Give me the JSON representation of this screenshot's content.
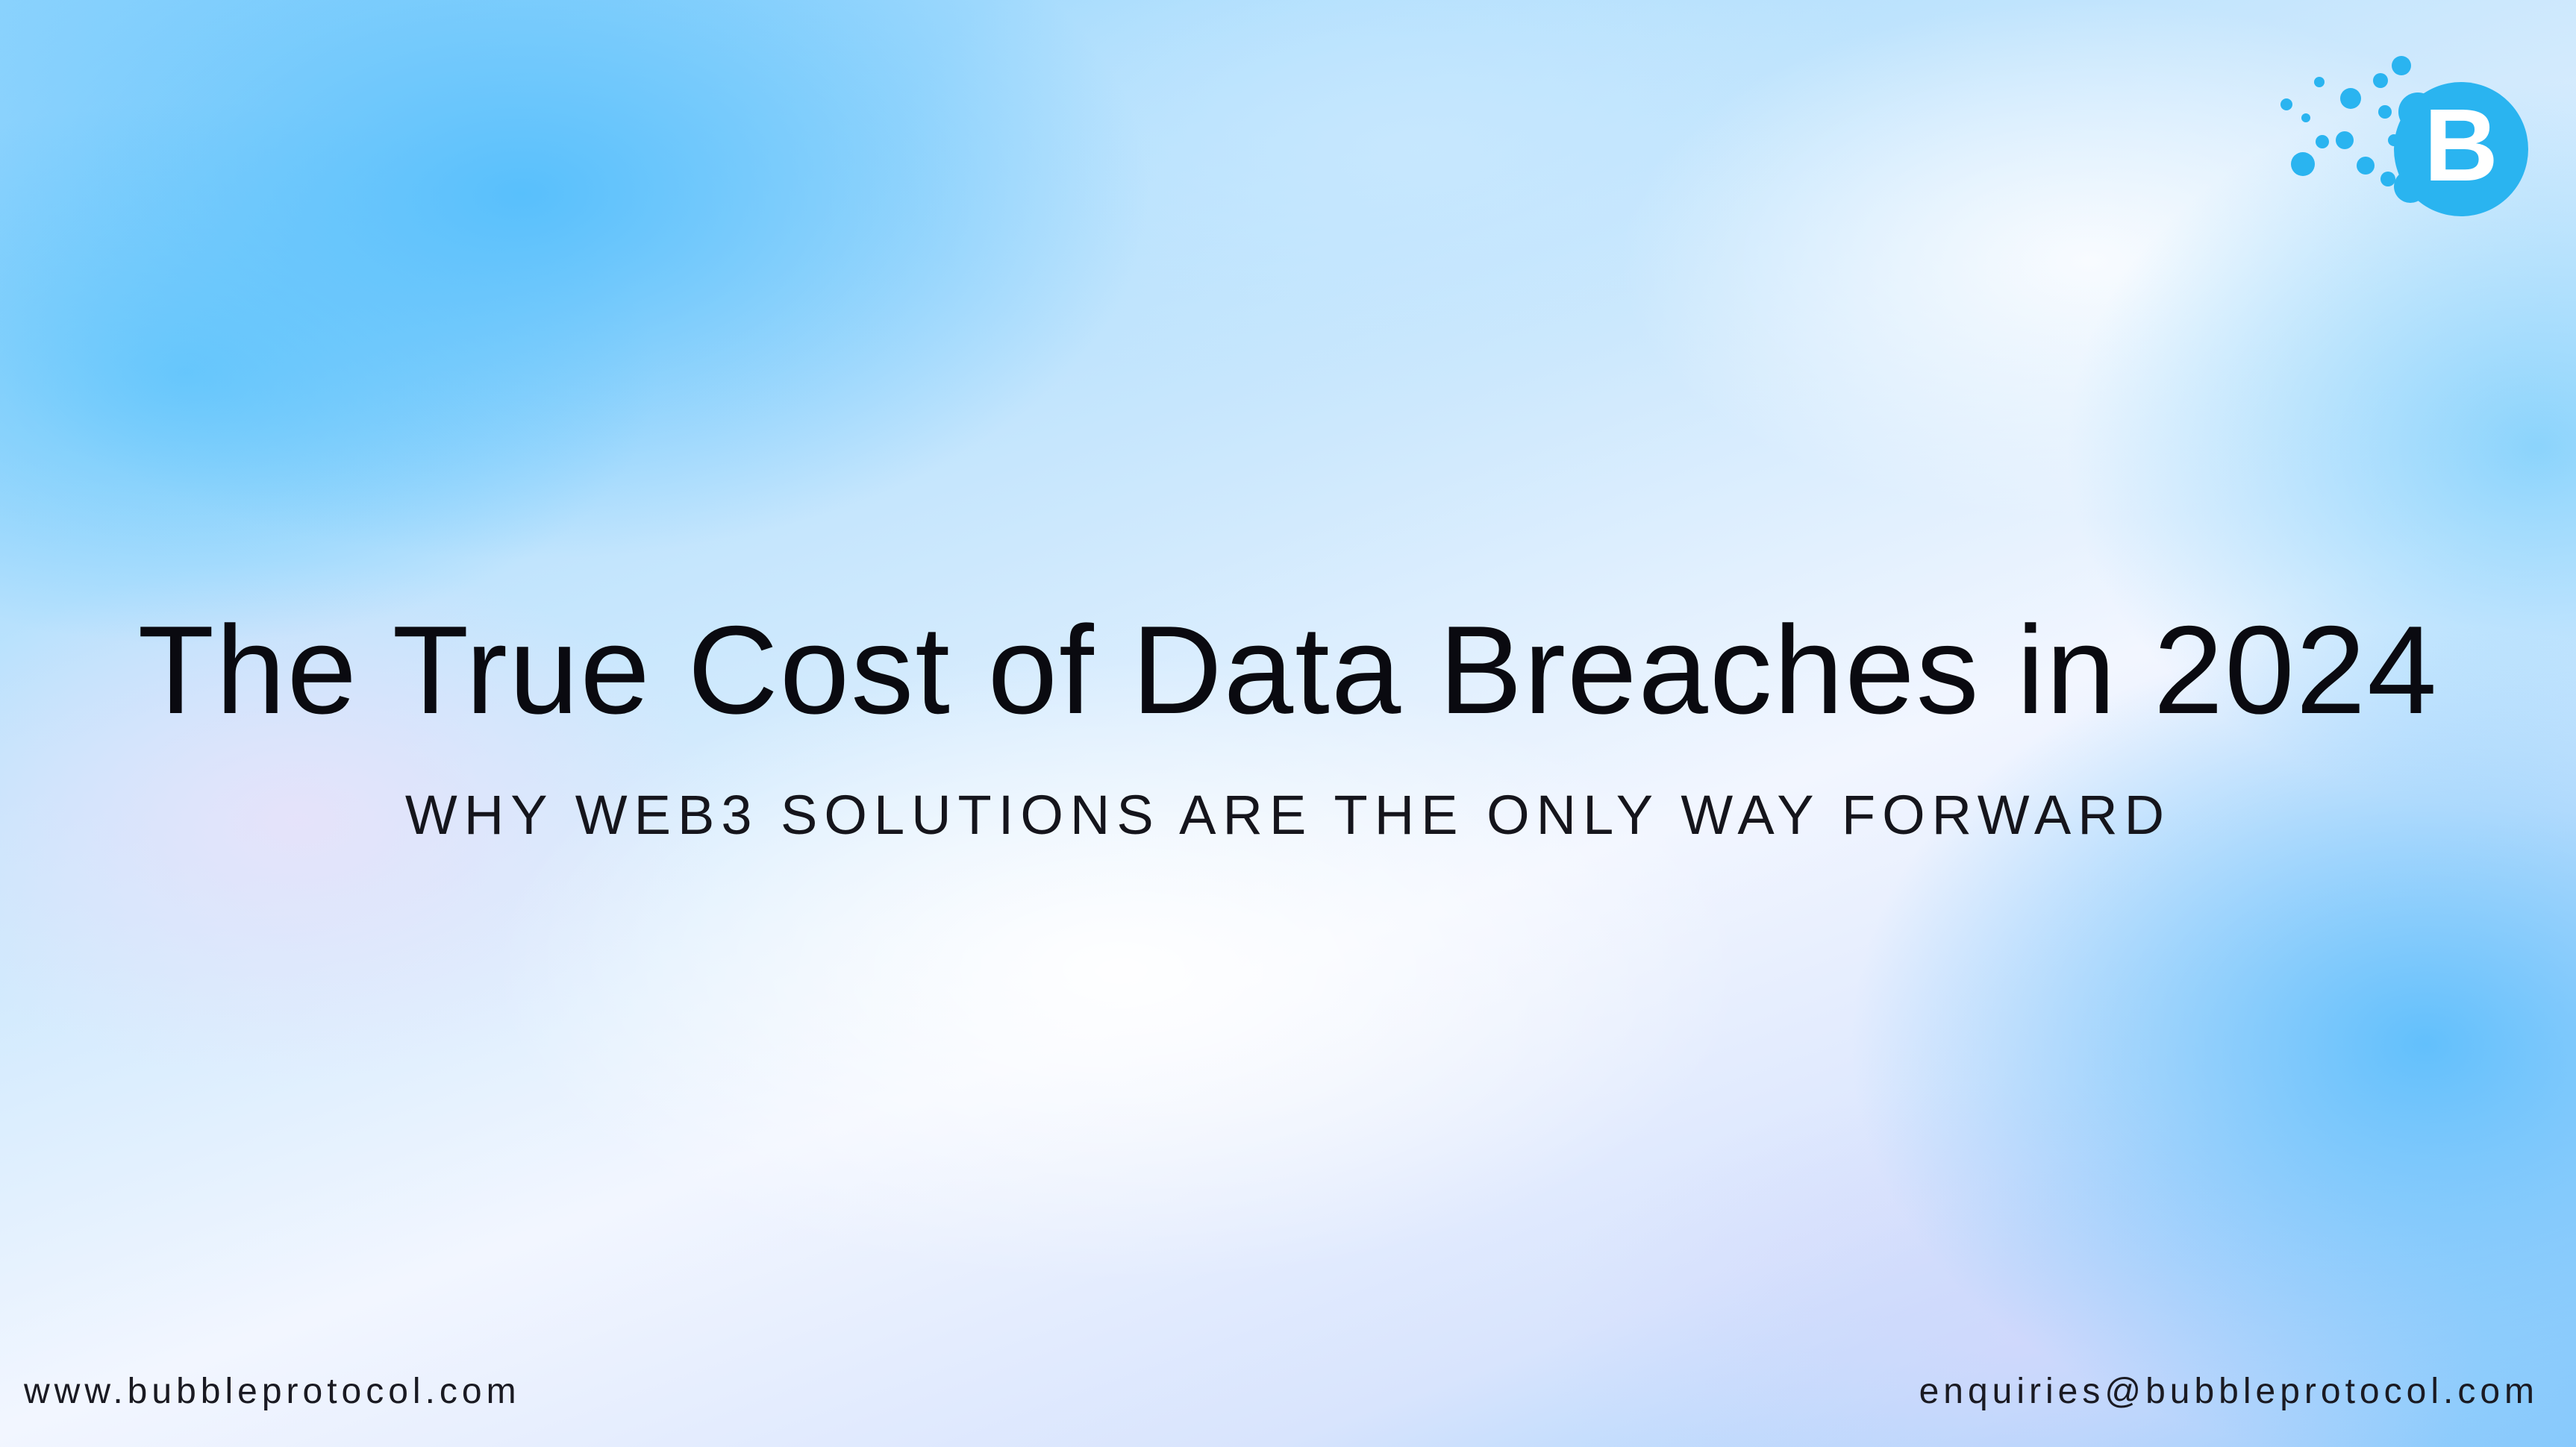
{
  "slide": {
    "title": "The True Cost of Data Breaches in 2024",
    "subtitle": "WHY WEB3 SOLUTIONS ARE THE ONLY WAY FORWARD"
  },
  "footer": {
    "website": "www.bubbleprotocol.com",
    "email": "enquiries@bubbleprotocol.com"
  },
  "logo": {
    "icon": "bubble-protocol-logo-icon",
    "letter": "B",
    "color": "#2ab4f0"
  },
  "colors": {
    "text": "#0a0a10",
    "accent": "#2ab4f0"
  }
}
